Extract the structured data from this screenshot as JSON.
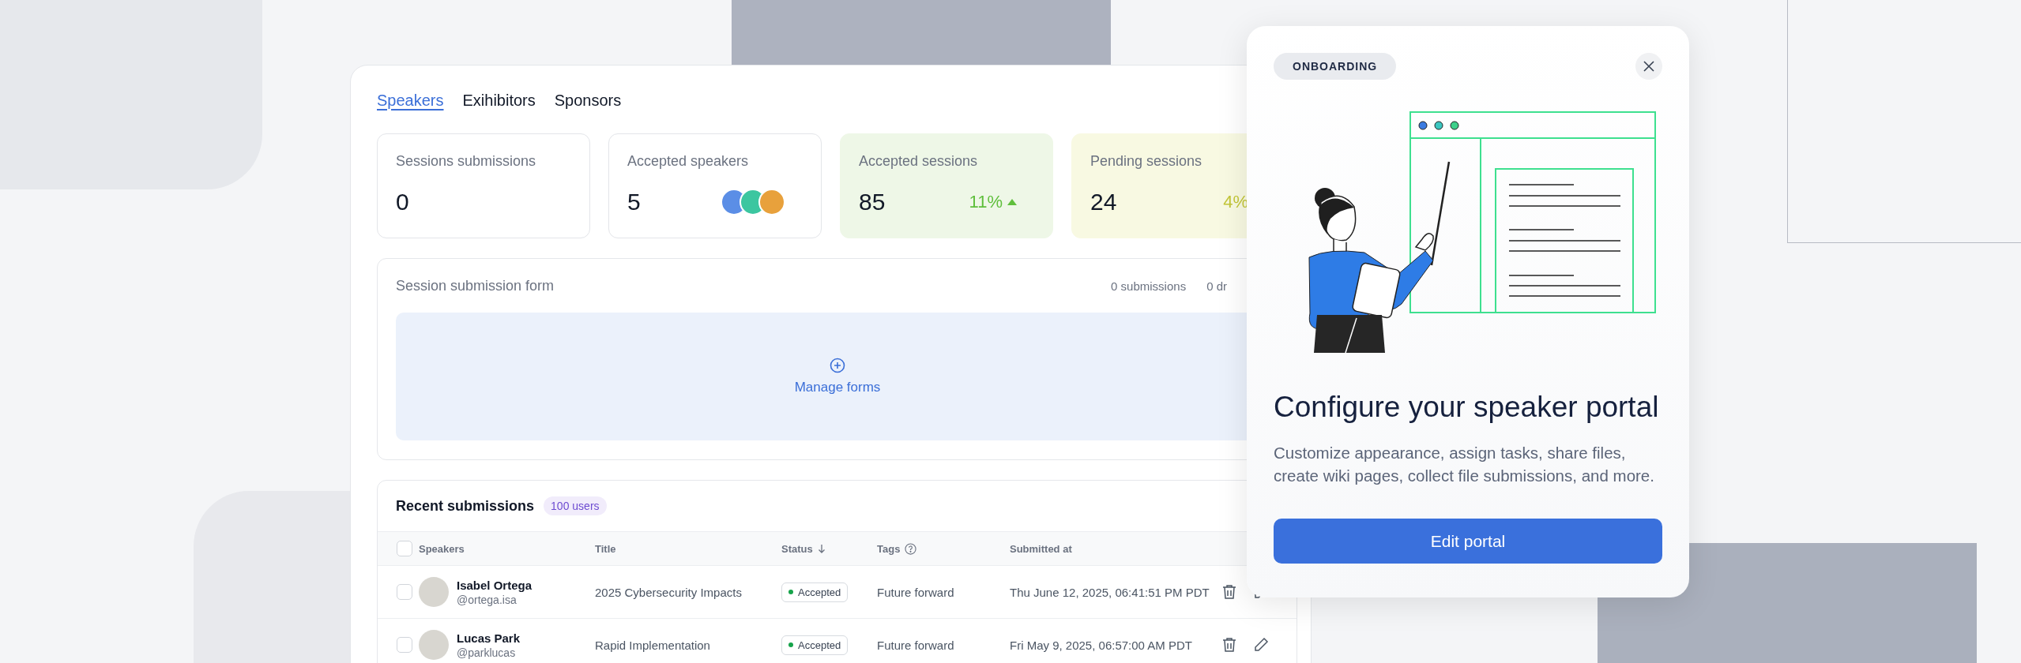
{
  "tabs": [
    {
      "label": "Speakers",
      "selected": true
    },
    {
      "label": "Exihibitors",
      "selected": false
    },
    {
      "label": "Sponsors",
      "selected": false
    }
  ],
  "stats": [
    {
      "kind": "plain",
      "label": "Sessions submissions",
      "value": "0"
    },
    {
      "kind": "avatars",
      "label": "Accepted speakers",
      "value": "5"
    },
    {
      "kind": "green",
      "label": "Accepted sessions",
      "value": "85",
      "change": "11%"
    },
    {
      "kind": "yellow",
      "label": "Pending sessions",
      "value": "24",
      "change": "4%"
    }
  ],
  "form": {
    "title": "Session submission form",
    "counts": [
      "0 submissions",
      "0 dr"
    ],
    "action": "Manage forms"
  },
  "submissions": {
    "title": "Recent submissions",
    "badge": "100 users",
    "all_checked": false,
    "columns": [
      {
        "label": "Speakers",
        "kind": "plain"
      },
      {
        "label": "Title",
        "kind": "plain"
      },
      {
        "label": "Status",
        "kind": "sorted"
      },
      {
        "label": "Tags",
        "kind": "help"
      },
      {
        "label": "Submitted at",
        "kind": "plain"
      }
    ],
    "rows": [
      {
        "checked": false,
        "name": "Isabel Ortega",
        "handle": "@ortega.isa",
        "title": "2025 Cybersecurity Impacts",
        "status": "Accepted",
        "tag": "Future forward",
        "submitted": "Thu June 12, 2025, 06:41:51 PM PDT"
      },
      {
        "checked": false,
        "name": "Lucas Park",
        "handle": "@parklucas",
        "title": "Rapid Implementation",
        "status": "Accepted",
        "tag": "Future forward",
        "submitted": "Fri May 9, 2025, 06:57:00 AM PDT"
      }
    ]
  },
  "popup": {
    "badge": "ONBOARDING",
    "title": "Configure your speaker portal",
    "description": "Customize appearance, assign tasks, share files, create wiki pages, collect file submissions, and more.",
    "button": "Edit portal"
  }
}
